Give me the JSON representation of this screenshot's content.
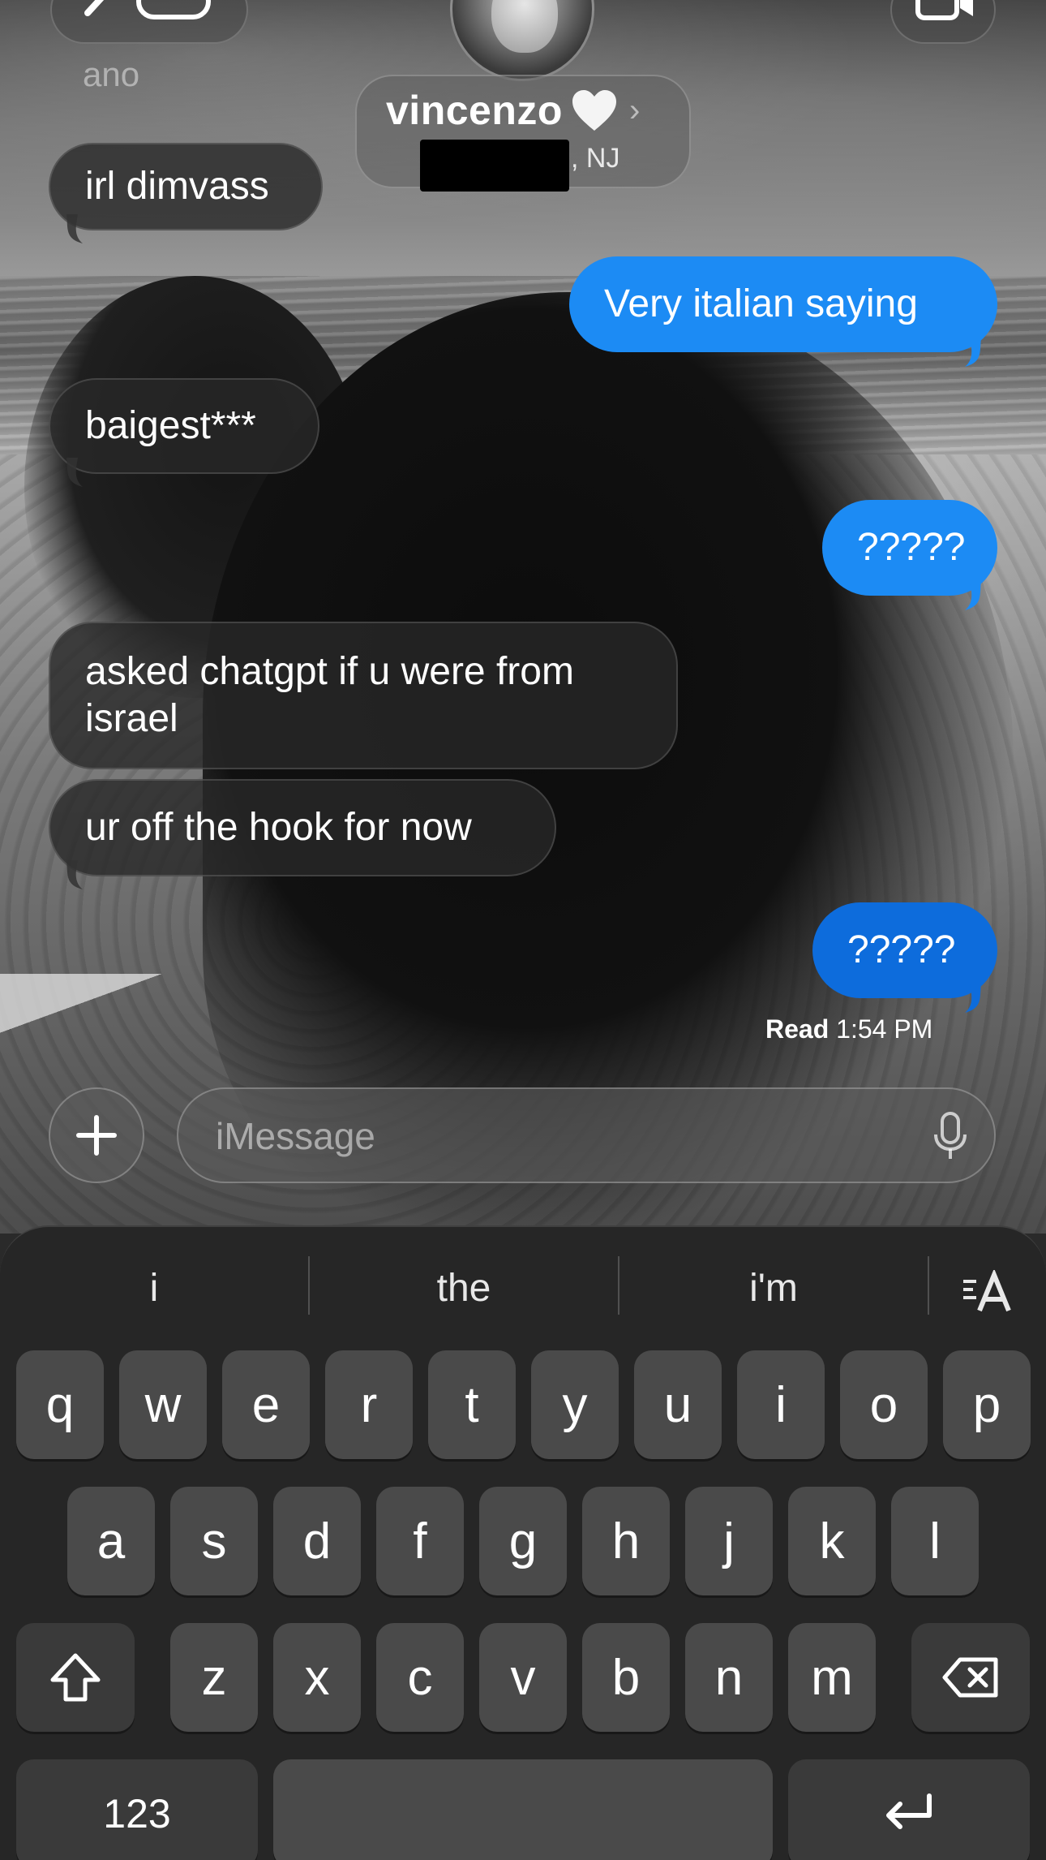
{
  "header": {
    "sender_label": "ano",
    "contact_name": "vincenzo",
    "location_suffix": ", NJ"
  },
  "messages": [
    {
      "from": "them",
      "text": "irl dimvass"
    },
    {
      "from": "me",
      "text": "Very italian saying"
    },
    {
      "from": "them",
      "text": "baigest***"
    },
    {
      "from": "me",
      "text": "?????"
    },
    {
      "from": "them",
      "text": "asked chatgpt if u were from israel"
    },
    {
      "from": "them",
      "text": "ur off the hook for now"
    },
    {
      "from": "me",
      "text": "?????"
    }
  ],
  "read_receipt": {
    "label": "Read",
    "time": "1:54 PM"
  },
  "compose": {
    "placeholder": "iMessage"
  },
  "keyboard": {
    "suggestions": [
      "i",
      "the",
      "i'm"
    ],
    "row1": [
      "q",
      "w",
      "e",
      "r",
      "t",
      "y",
      "u",
      "i",
      "o",
      "p"
    ],
    "row2": [
      "a",
      "s",
      "d",
      "f",
      "g",
      "h",
      "j",
      "k",
      "l"
    ],
    "row3": [
      "z",
      "x",
      "c",
      "v",
      "b",
      "n",
      "m"
    ],
    "numbers_label": "123"
  },
  "colors": {
    "outgoing_bubble": "#1c8bf4",
    "outgoing_bubble_last": "#0d6cdc",
    "incoming_bubble": "#282828",
    "keyboard_bg": "#262626",
    "key_bg": "#4a4a4a"
  },
  "icons": [
    "chevron-left-icon",
    "video-camera-icon",
    "heart-icon",
    "chevron-right-icon",
    "plus-icon",
    "microphone-icon",
    "text-format-icon",
    "shift-icon",
    "delete-icon",
    "return-icon"
  ]
}
